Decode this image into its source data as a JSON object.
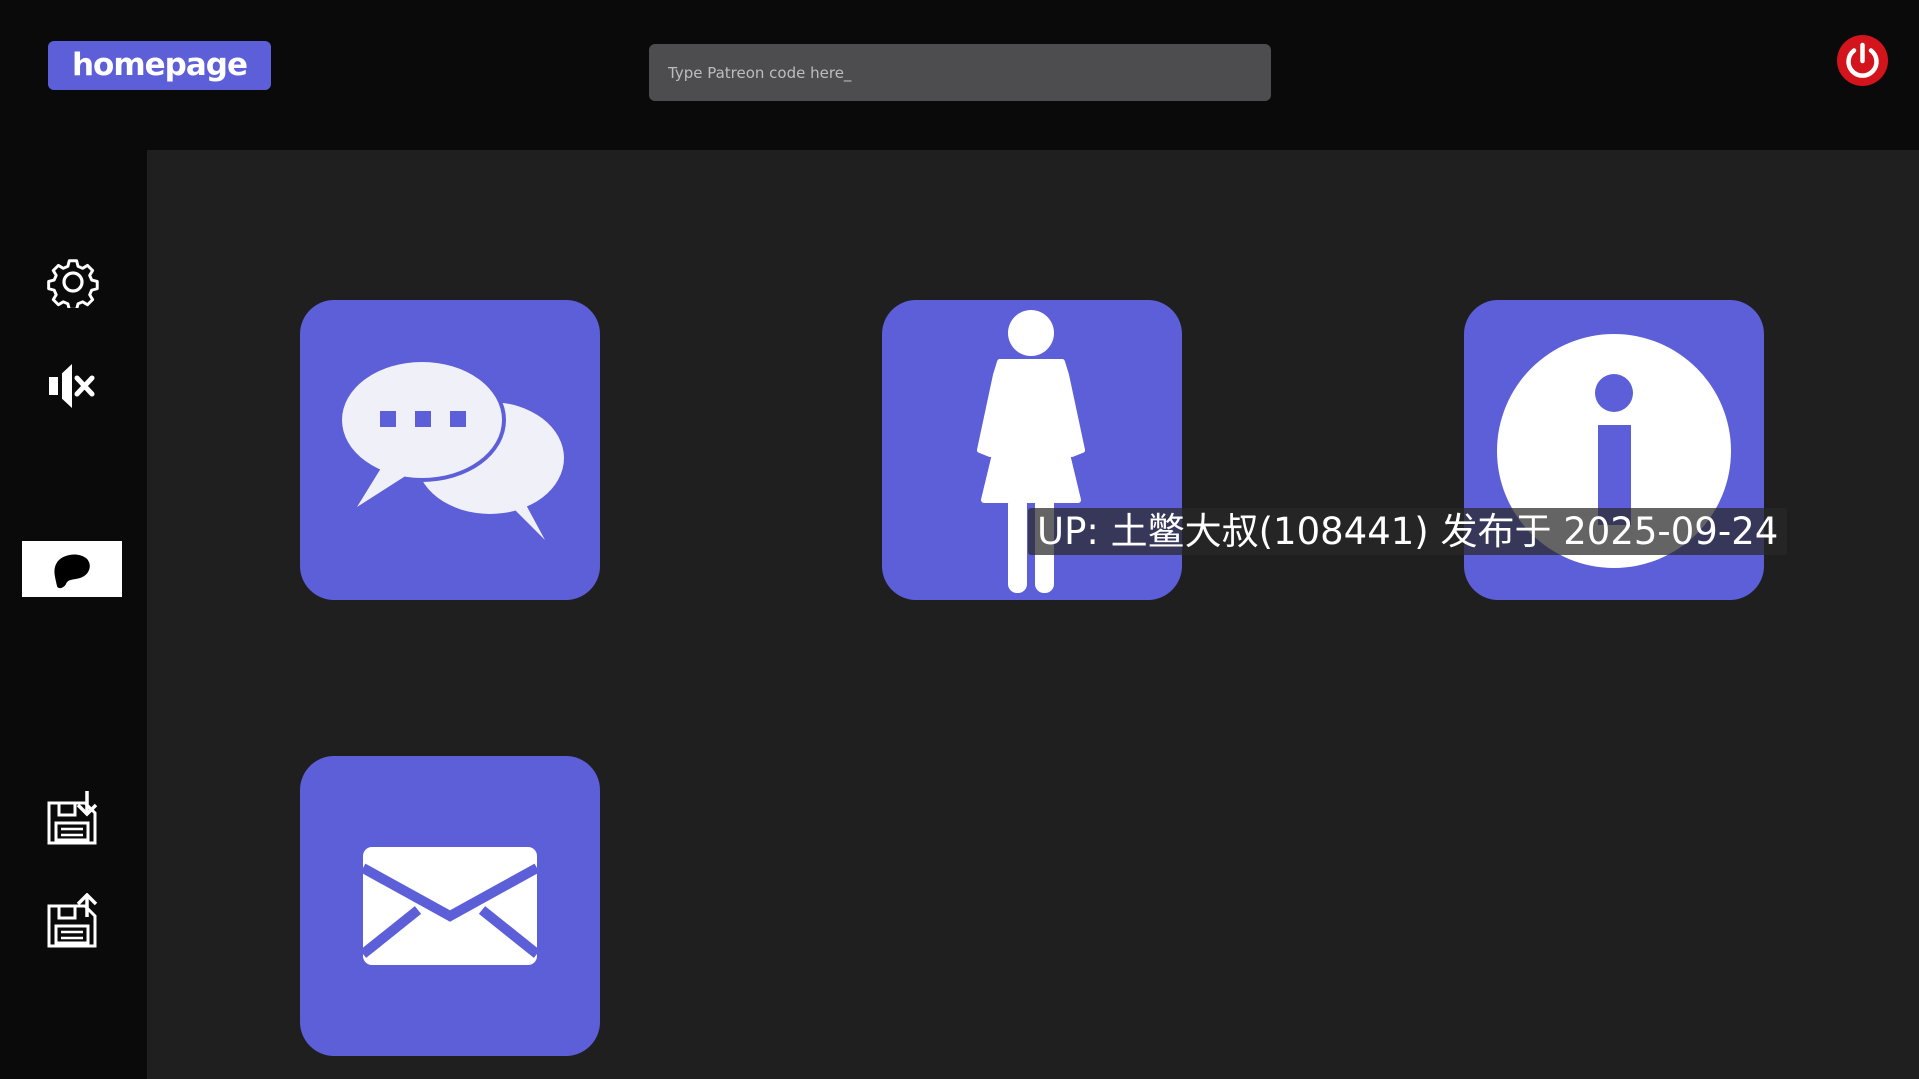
{
  "header": {
    "home_label": "homepage",
    "search_placeholder": "Type Patreon code here_",
    "power_icon": "power-icon"
  },
  "sidebar": {
    "items": [
      {
        "icon": "gear-icon"
      },
      {
        "icon": "mute-icon"
      },
      {
        "icon": "patreon-icon"
      },
      {
        "icon": "save-download-icon"
      },
      {
        "icon": "save-upload-icon"
      }
    ]
  },
  "tiles": [
    {
      "icon": "chat-bubbles-icon"
    },
    {
      "icon": "woman-icon"
    },
    {
      "icon": "info-icon"
    },
    {
      "icon": "mail-icon"
    }
  ],
  "overlay": {
    "text": "UP: 土鳖大叔(108441) 发布于 2025-09-24"
  },
  "colors": {
    "accent": "#5c5fd8",
    "background": "#0a0a0a",
    "panel": "#1f1f1f",
    "search_bg": "#4d4d4f",
    "power": "#d3141c"
  }
}
